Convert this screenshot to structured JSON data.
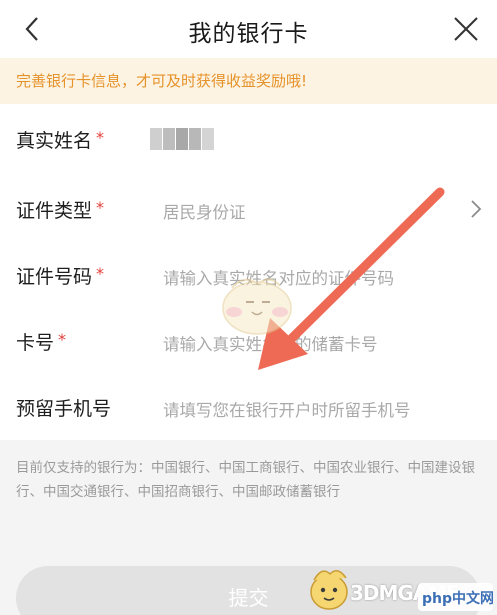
{
  "header": {
    "title": "我的银行卡",
    "back_icon": "chevron-left-icon",
    "close_icon": "close-icon"
  },
  "notice": {
    "text": "完善银行卡信息，才可及时获得收益奖励哦!",
    "color": "#e6922a",
    "background": "#fdf3e3"
  },
  "form": {
    "name": {
      "label": "真实姓名",
      "required": "*"
    },
    "id_type": {
      "label": "证件类型",
      "required": "*",
      "value": "居民身份证",
      "icon": "chevron-right-icon"
    },
    "id_number": {
      "label": "证件号码",
      "required": "*",
      "placeholder": "请输入真实姓名对应的证件号码"
    },
    "card_number": {
      "label": "卡号",
      "required": "*",
      "placeholder": "请输入真实姓名下的储蓄卡号"
    },
    "phone": {
      "label": "预留手机号",
      "placeholder": "请填写您在银行开户时所留手机号"
    }
  },
  "support_text": "目前仅支持的银行为：中国银行、中国工商银行、中国农业银行、中国建设银行、中国交通银行、中国招商银行、中国邮政储蓄银行",
  "submit_label": "提交",
  "watermark": {
    "text": "3DMGAME",
    "logo_text": "php中文网"
  },
  "colors": {
    "required": "#e0403a",
    "arrow": "#ee6a54",
    "placeholder": "#a9a9a9"
  }
}
